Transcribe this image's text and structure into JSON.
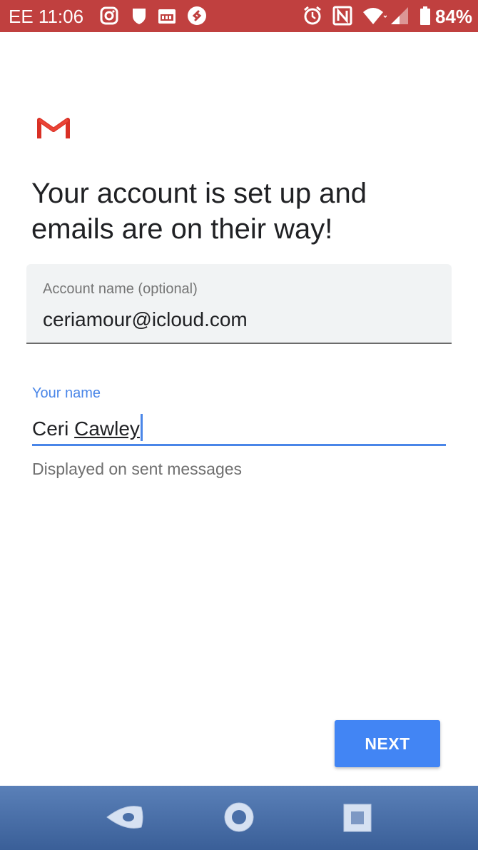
{
  "status_bar": {
    "carrier_time": "EE 11:06",
    "battery": "84%",
    "icons": [
      "instagram-icon",
      "shield-icon",
      "calendar-icon",
      "shazam-icon",
      "alarm-icon",
      "nfc-icon",
      "wifi-icon",
      "signal-icon",
      "battery-icon"
    ]
  },
  "app": {
    "logo": "gmail-icon",
    "headline": "Your account is set up and emails are on their way!"
  },
  "account_name_field": {
    "label": "Account name (optional)",
    "value": "ceriamour@icloud.com"
  },
  "your_name_field": {
    "label": "Your name",
    "value_word1": "Ceri",
    "value_word2": "Cawley",
    "helper": "Displayed on sent messages"
  },
  "actions": {
    "next_label": "NEXT"
  },
  "nav_bar": {
    "icons": [
      "back-icon",
      "home-icon",
      "recents-icon"
    ]
  },
  "colors": {
    "status_bar": "#c0403f",
    "accent": "#4285f4",
    "field_bg": "#f1f3f4",
    "nav_bar": "#4a6fa8"
  }
}
